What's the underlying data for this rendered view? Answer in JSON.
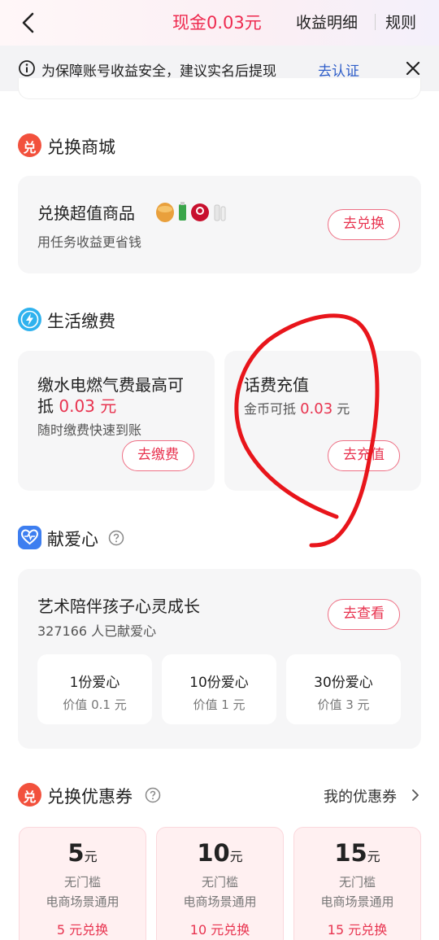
{
  "header": {
    "title": "现金0.03元",
    "detail_label": "收益明细",
    "rules_label": "规则"
  },
  "notice": {
    "text": "为保障账号收益安全，建议实名后提现",
    "link": "去认证"
  },
  "exchange_mall": {
    "section_title": "兑换商城",
    "icon_char": "兑",
    "card_title": "兑换超值商品",
    "card_sub": "用任务收益更省钱",
    "button": "去兑换"
  },
  "life_pay": {
    "section_title": "生活缴费",
    "utility": {
      "title_line1": "缴水电燃气费最高可",
      "title_line2_prefix": "抵",
      "amount": "0.03 元",
      "sub": "随时缴费快速到账",
      "button": "去缴费"
    },
    "phone": {
      "title": "话费充值",
      "sub_prefix": "金币可抵",
      "amount": "0.03",
      "sub_suffix": "元",
      "button": "去充值"
    }
  },
  "donate": {
    "section_title": "献爱心",
    "card_title": "艺术陪伴孩子心灵成长",
    "card_sub": "327166 人已献爱心",
    "button": "去查看",
    "options": [
      {
        "name": "1份爱心",
        "value": "价值 0.1 元"
      },
      {
        "name": "10份爱心",
        "value": "价值 1 元"
      },
      {
        "name": "30份爱心",
        "value": "价值 3 元"
      }
    ]
  },
  "coupons": {
    "section_title": "兑换优惠券",
    "icon_char": "兑",
    "my_coupons": "我的优惠券",
    "items": [
      {
        "amount": "5",
        "unit": "元",
        "line1": "无门槛",
        "line2": "电商场景通用",
        "action": "5 元兑换"
      },
      {
        "amount": "10",
        "unit": "元",
        "line1": "无门槛",
        "line2": "电商场景通用",
        "action": "10 元兑换"
      },
      {
        "amount": "15",
        "unit": "元",
        "line1": "无门槛",
        "line2": "电商场景通用",
        "action": "15 元兑换"
      }
    ]
  },
  "colors": {
    "accent_red": "#e8334f",
    "link_blue": "#2f5ec9",
    "scribble_red": "#e8151b"
  }
}
